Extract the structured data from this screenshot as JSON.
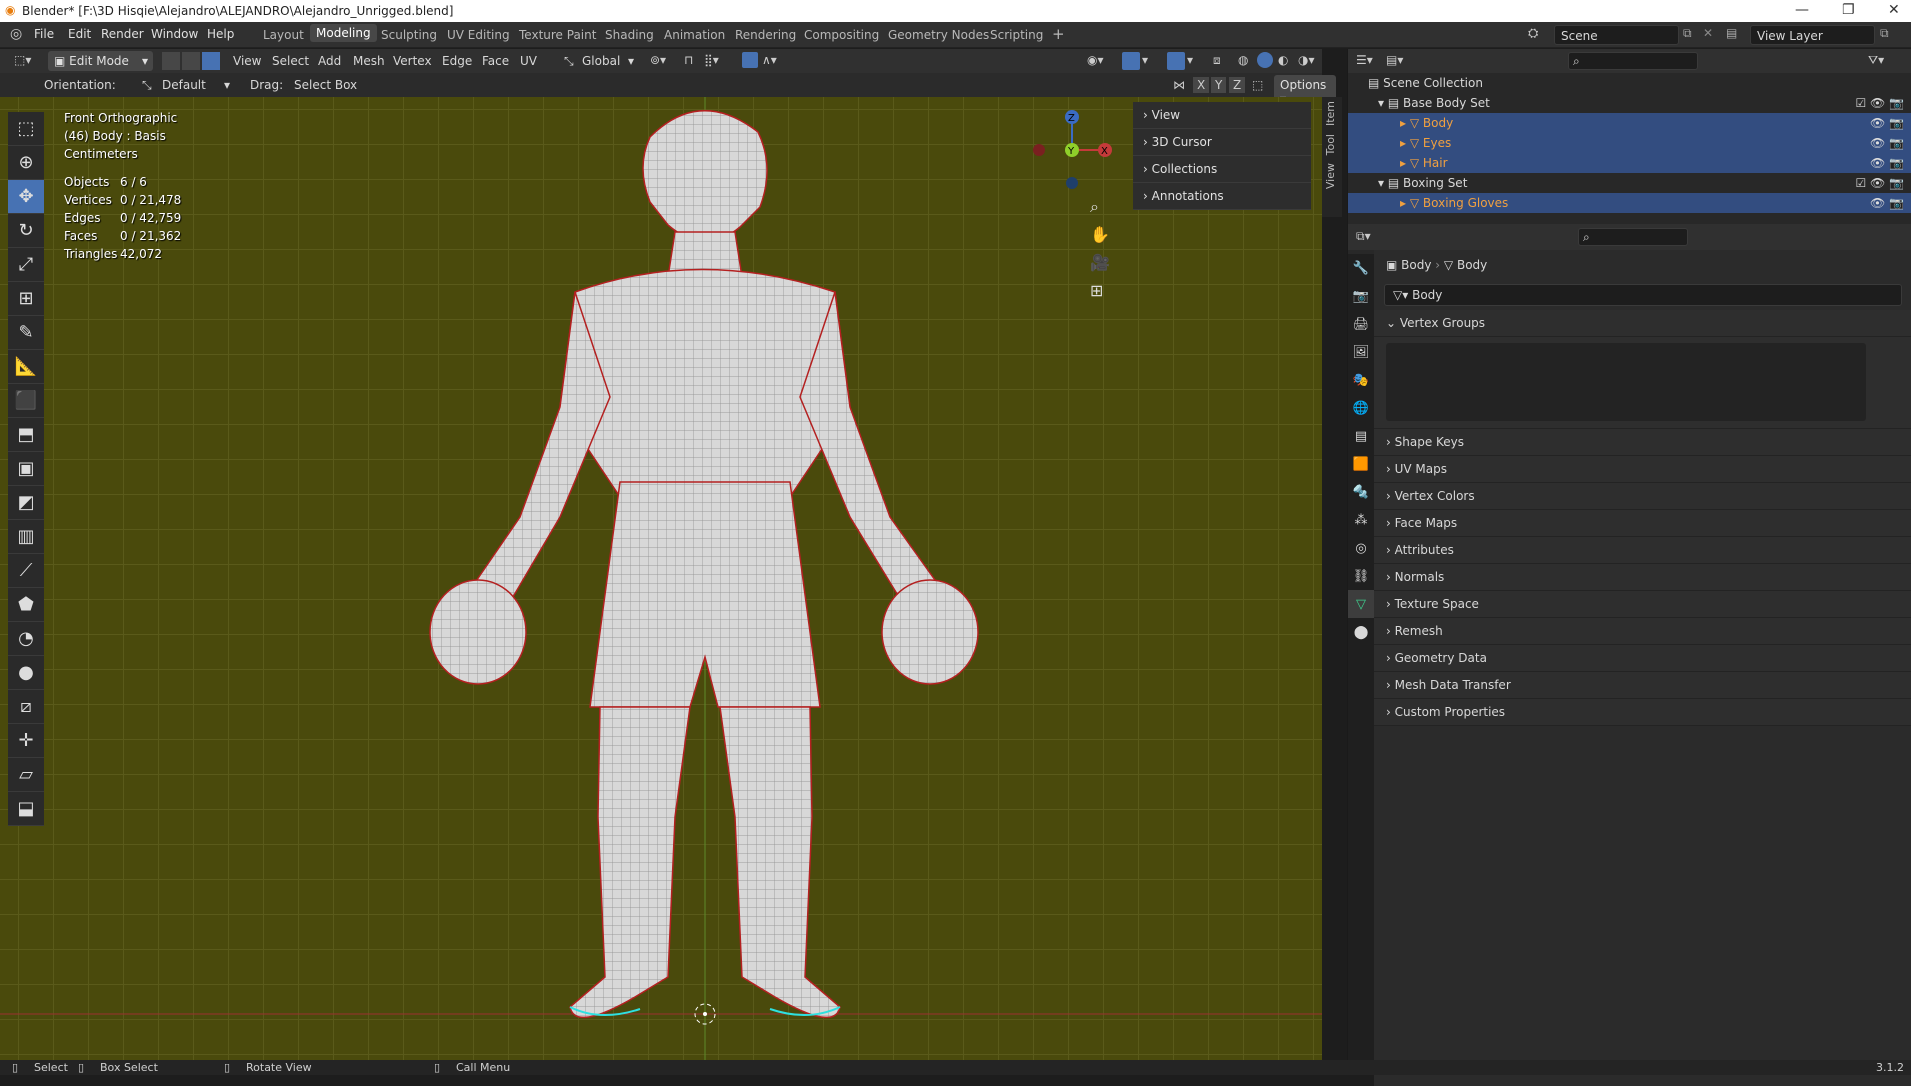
{
  "titlebar": {
    "title": "Blender* [F:\\3D Hisqie\\Alejandro\\ALEJANDRO\\Alejandro_Unrigged.blend]"
  },
  "menubar": {
    "items": [
      "File",
      "Edit",
      "Render",
      "Window",
      "Help"
    ]
  },
  "workspaces": {
    "tabs": [
      "Layout",
      "Modeling",
      "Sculpting",
      "UV Editing",
      "Texture Paint",
      "Shading",
      "Animation",
      "Rendering",
      "Compositing",
      "Geometry Nodes",
      "Scripting"
    ],
    "active": "Modeling",
    "add": "+"
  },
  "scene": {
    "label": "Scene",
    "view_layer": "View Layer"
  },
  "header": {
    "mode": "Edit Mode",
    "menus": [
      "View",
      "Select",
      "Add",
      "Mesh",
      "Vertex",
      "Edge",
      "Face",
      "UV"
    ],
    "transform": "Global",
    "orientation_label": "Orientation:",
    "orientation": "Default",
    "drag_label": "Drag:",
    "drag": "Select Box",
    "options": "Options",
    "axes": [
      "X",
      "Y",
      "Z"
    ]
  },
  "overlay": {
    "view": "Front Orthographic",
    "object": "(46) Body : Basis",
    "units": "Centimeters",
    "stats": [
      {
        "k": "Objects",
        "v": "6 / 6"
      },
      {
        "k": "Vertices",
        "v": "0 / 21,478"
      },
      {
        "k": "Edges",
        "v": "0 / 42,759"
      },
      {
        "k": "Faces",
        "v": "0 / 21,362"
      },
      {
        "k": "Triangles",
        "v": "42,072"
      }
    ]
  },
  "gizmo": {
    "z": "Z",
    "y": "Y",
    "x": "X"
  },
  "npanel": {
    "rows": [
      "View",
      "3D Cursor",
      "Collections",
      "Annotations"
    ],
    "tabs": [
      "Item",
      "Tool",
      "View"
    ]
  },
  "outliner": {
    "root": "Scene Collection",
    "rows": [
      {
        "label": "Base Body Set",
        "type": "collection"
      },
      {
        "label": "Body",
        "type": "mesh"
      },
      {
        "label": "Eyes",
        "type": "mesh"
      },
      {
        "label": "Hair",
        "type": "mesh"
      },
      {
        "label": "Boxing Set",
        "type": "collection"
      },
      {
        "label": "Boxing Gloves",
        "type": "mesh"
      }
    ]
  },
  "properties": {
    "breadcrumb": [
      "Body",
      "Body"
    ],
    "datablock": "Body",
    "vertex_groups": "Vertex Groups",
    "sections": [
      "Shape Keys",
      "UV Maps",
      "Vertex Colors",
      "Face Maps",
      "Attributes",
      "Normals",
      "Texture Space",
      "Remesh",
      "Geometry Data",
      "Mesh Data Transfer",
      "Custom Properties"
    ]
  },
  "statusbar": {
    "items": [
      "Select",
      "Box Select",
      "Rotate View",
      "Call Menu"
    ],
    "version": "3.1.2"
  },
  "colors": {
    "accent": "#4772b3",
    "viewport_bg": "#4a4a0c",
    "edge_seam": "#d02020",
    "selection": "#334d80"
  }
}
